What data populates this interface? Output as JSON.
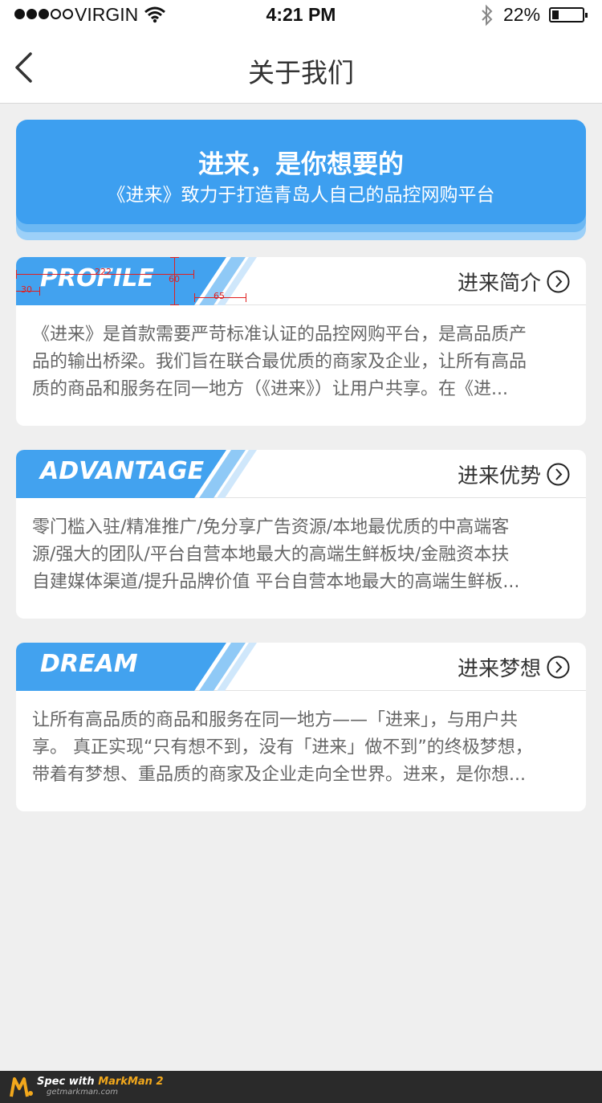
{
  "status_bar": {
    "carrier": "VIRGIN",
    "time": "4:21 PM",
    "battery": "22%",
    "signal_bars_filled": 3,
    "signal_bars_total": 5
  },
  "nav": {
    "title": "关于我们",
    "back_icon": "chevron-left-icon"
  },
  "banner": {
    "title": "进来，是你想要的",
    "subtitle": "《进来》致力于打造青岛人自己的品控网购平台"
  },
  "cards": [
    {
      "tag": "PROFILE",
      "title": "进来简介",
      "lines": [
        "《进来》是首款需要严苛标准认证的品控网购平台，是高品质产",
        "品的输出桥梁。我们旨在联合最优质的商家及企业，让所有高品",
        "质的商品和服务在同一地方（《进来》）让用户共享。在《进..."
      ]
    },
    {
      "tag": "ADVANTAGE",
      "title": "进来优势",
      "lines": [
        "零门槛入驻/精准推广/免分享广告资源/本地最优质的中高端客",
        "源/强大的团队/平台自营本地最大的高端生鲜板块/金融资本扶",
        "自建媒体渠道/提升品牌价值 平台自营本地最大的高端生鲜板..."
      ]
    },
    {
      "tag": "DREAM",
      "title": "进来梦想",
      "lines": [
        "让所有高品质的商品和服务在同一地方——「进来」，与用户共",
        "享。 真正实现“只有想不到，没有「进来」做不到”的终极梦想，",
        "带着有梦想、重品质的商家及企业走向全世界。进来，是你想..."
      ]
    }
  ],
  "spec_annotations": {
    "width": "222",
    "height": "60",
    "left": "30",
    "gap": "65"
  },
  "footer": {
    "brand_prefix": "Spec with ",
    "brand": "MarkMan 2",
    "url": "getmarkman.com"
  },
  "colors": {
    "accent": "#3d9ff0",
    "background": "#efefef"
  }
}
